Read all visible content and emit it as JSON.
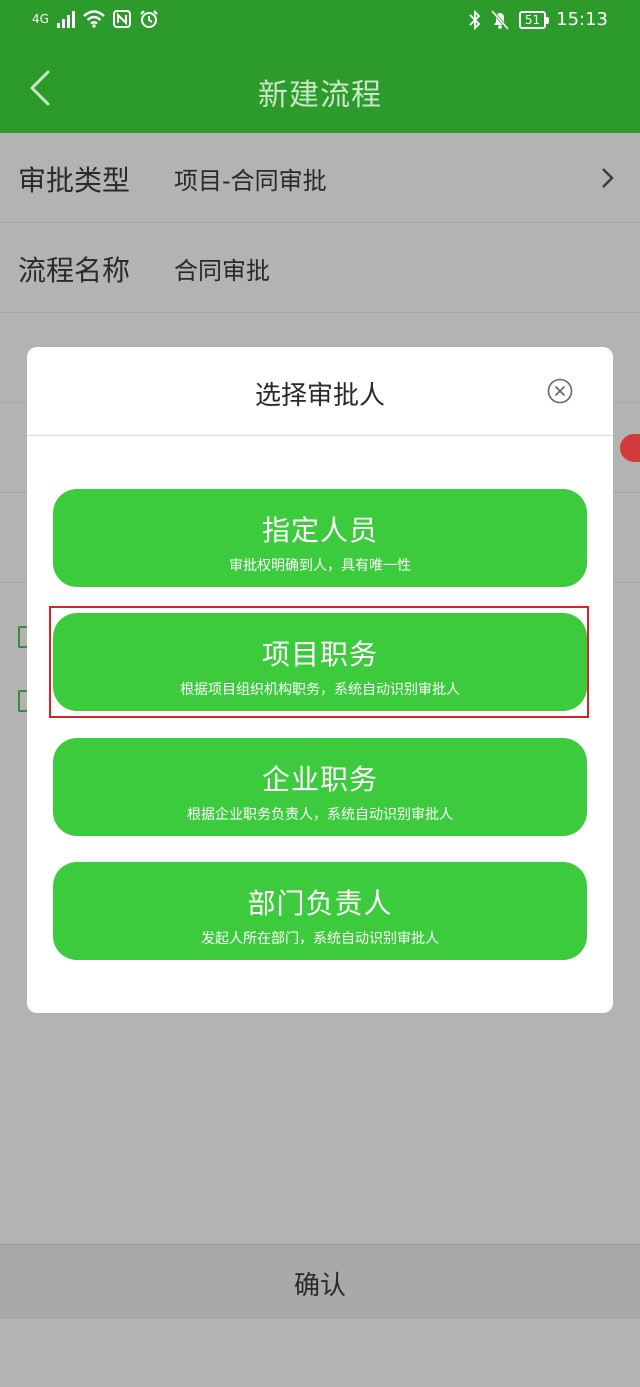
{
  "status_bar": {
    "network": "4G",
    "battery": "51",
    "time": "15:13"
  },
  "header": {
    "title": "新建流程",
    "back_icon": "chevron-left-icon"
  },
  "form": {
    "rows": [
      {
        "label": "审批类型",
        "value": "项目-合同审批"
      },
      {
        "label": "流程名称",
        "value": "合同审批"
      }
    ]
  },
  "footer": {
    "confirm_label": "确认"
  },
  "modal": {
    "title": "选择审批人",
    "close_icon": "close-circle-icon",
    "options": [
      {
        "title": "指定人员",
        "subtitle": "审批权明确到人，具有唯一性"
      },
      {
        "title": "项目职务",
        "subtitle": "根据项目组织机构职务，系统自动识别审批人"
      },
      {
        "title": "企业职务",
        "subtitle": "根据企业职务负责人，系统自动识别审批人"
      },
      {
        "title": "部门负责人",
        "subtitle": "发起人所在部门，系统自动识别审批人"
      }
    ]
  },
  "colors": {
    "header_green": "#2c9b2c",
    "button_green": "#3ccb3c",
    "highlight_red": "#d42424"
  }
}
